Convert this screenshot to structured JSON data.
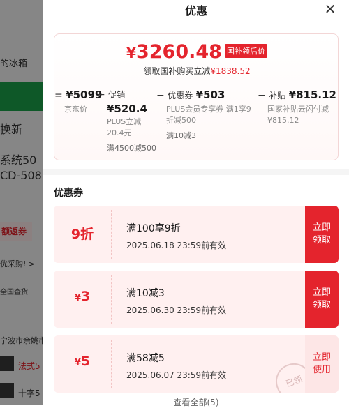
{
  "background": {
    "rows": [
      "的冰箱",
      "换新",
      "系统50",
      "CD-508",
      "额返券",
      "优采购! >",
      "全国查货",
      "宁波市余姚市",
      "法式5",
      "十字5"
    ]
  },
  "sheet": {
    "title": "优惠",
    "close_icon": "close-icon"
  },
  "price_summary": {
    "currency": "¥",
    "final_price": "3260.48",
    "final_badge": "国补领后价",
    "subsidy_text": "领取国补购买立减",
    "subsidy_amount": "¥1838.52",
    "jd_price": {
      "op": "=",
      "value": "¥5099",
      "label": "京东价"
    },
    "promo": {
      "op": "−",
      "label": "促销",
      "value": "¥520.4",
      "detail1": "PLUS立减",
      "detail2": "20.4元",
      "detail3": "满4500减500"
    },
    "coupon": {
      "op": "−",
      "label": "优惠券",
      "value": "¥503",
      "detail1": "PLUS会员专享券 满1享9",
      "detail2": "折减500",
      "detail3": "满10减3"
    },
    "subsidy": {
      "op": "−",
      "label": "补贴",
      "value": "¥815.12",
      "detail1": "国家补贴云闪付减",
      "detail2": "¥815.12"
    }
  },
  "coupons_section": {
    "title": "优惠券",
    "items": [
      {
        "value": "9折",
        "yen": "",
        "name": "满100享9折",
        "date": "2025.06.18 23:59前有效",
        "button": [
          "立即",
          "领取"
        ],
        "state": "claim"
      },
      {
        "value": "3",
        "yen": "¥",
        "name": "满10减3",
        "date": "2025.06.30 23:59前有效",
        "button": [
          "立即",
          "领取"
        ],
        "state": "claim"
      },
      {
        "value": "5",
        "yen": "¥",
        "name": "满58减5",
        "date": "2025.06.07 23:59前有效",
        "button": [
          "立即",
          "使用"
        ],
        "state": "used",
        "stamp": "已领"
      }
    ],
    "view_all": "查看全部(5)"
  },
  "colors": {
    "accent": "#e4242d",
    "coupon_bg": "#fff0f0",
    "used_btn_bg": "#fde6e6"
  }
}
